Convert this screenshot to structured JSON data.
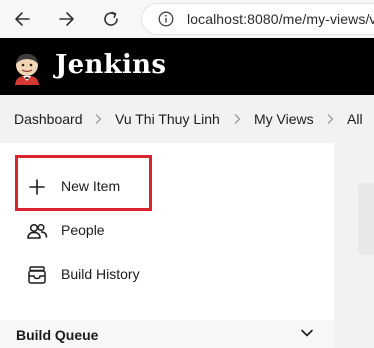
{
  "browser": {
    "url": "localhost:8080/me/my-views/v"
  },
  "header": {
    "brand": "Jenkins"
  },
  "breadcrumb": {
    "items": [
      "Dashboard",
      "Vu Thi Thuy Linh",
      "My Views",
      "All"
    ]
  },
  "side_panel": {
    "tasks": [
      {
        "label": "New Item",
        "icon": "plus-icon"
      },
      {
        "label": "People",
        "icon": "people-icon"
      },
      {
        "label": "Build History",
        "icon": "build-history-icon"
      }
    ]
  },
  "build_queue": {
    "title": "Build Queue"
  },
  "colors": {
    "header_bg": "#000000",
    "breadcrumb_bg": "#f2f2f3",
    "highlight": "#d9232e"
  }
}
